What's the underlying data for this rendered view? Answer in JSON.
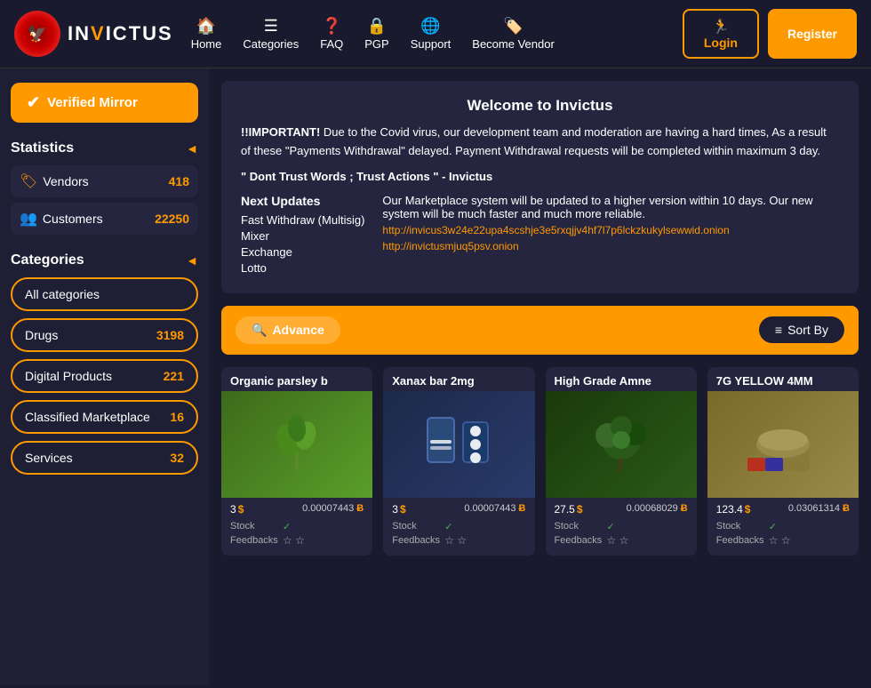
{
  "header": {
    "logo_text_main": "IN",
    "logo_text_v": "V",
    "logo_text_rest": "ICTUS",
    "nav": [
      {
        "label": "Home",
        "icon": "🏠",
        "id": "home"
      },
      {
        "label": "Categories",
        "icon": "☰",
        "id": "categories"
      },
      {
        "label": "FAQ",
        "icon": "❓",
        "id": "faq"
      },
      {
        "label": "PGP",
        "icon": "🔒",
        "id": "pgp"
      },
      {
        "label": "Support",
        "icon": "🌐",
        "id": "support"
      },
      {
        "label": "Become Vendor",
        "icon": "🏷️",
        "id": "become-vendor"
      }
    ],
    "login_label": "Login",
    "register_label": "Register"
  },
  "sidebar": {
    "verified_mirror_label": "Verified Mirror",
    "stats_title": "Statistics",
    "vendors_label": "Vendors",
    "vendors_count": "418",
    "customers_label": "Customers",
    "customers_count": "22250",
    "categories_title": "Categories",
    "categories": [
      {
        "label": "All categories",
        "count": "",
        "id": "all"
      },
      {
        "label": "Drugs",
        "count": "3198",
        "id": "drugs"
      },
      {
        "label": "Digital Products",
        "count": "221",
        "id": "digital"
      },
      {
        "label": "Classified Marketplace",
        "count": "16",
        "id": "classified"
      },
      {
        "label": "Services",
        "count": "32",
        "id": "services"
      }
    ]
  },
  "welcome": {
    "title": "Welcome to Invictus",
    "important_text": "!!IMPORTANT! Due to the Covid virus, our development team and moderation are having a hard times, As a result of these \"Payments Withdrawal\" delayed. Payment Withdrawal requests will be completed within maximum 3 day.",
    "quote": "\" Dont Trust Words ; Trust Actions \" - Invictus",
    "next_updates_title": "Next Updates",
    "update_items": [
      "Fast Withdraw (Multisig)",
      "Mixer",
      "Exchange",
      "Lotto"
    ],
    "update_description": "Our Marketplace system will be updated to a higher version within 10 days. Our new system will be much faster and much more reliable.",
    "onion_link1": "http://invicus3w24e22upa4scshje3e5rxqjjv4hf7l7p6lckzkukylsewwid.onion",
    "onion_link2": "http://invictusmjuq5psv.onion"
  },
  "search_bar": {
    "advance_label": "Advance",
    "sort_label": "Sort By"
  },
  "products": [
    {
      "title": "Organic parsley b",
      "price_usd": "3",
      "price_btc": "0.00007443",
      "stock": true,
      "feedbacks_count": 2,
      "image_type": "parsley"
    },
    {
      "title": "Xanax bar 2mg",
      "price_usd": "3",
      "price_btc": "0.00007443",
      "stock": true,
      "feedbacks_count": 2,
      "image_type": "xanax"
    },
    {
      "title": "High Grade Amne",
      "price_usd": "27.5",
      "price_btc": "0.00068029",
      "stock": true,
      "feedbacks_count": 2,
      "image_type": "weed"
    },
    {
      "title": "7G YELLOW 4MM",
      "price_usd": "123.4",
      "price_btc": "0.03061314",
      "stock": true,
      "feedbacks_count": 2,
      "image_type": "powder"
    }
  ],
  "colors": {
    "accent": "#f90",
    "background": "#1a1a2e",
    "card_bg": "#252540",
    "sidebar_bg": "#1e1e35"
  }
}
